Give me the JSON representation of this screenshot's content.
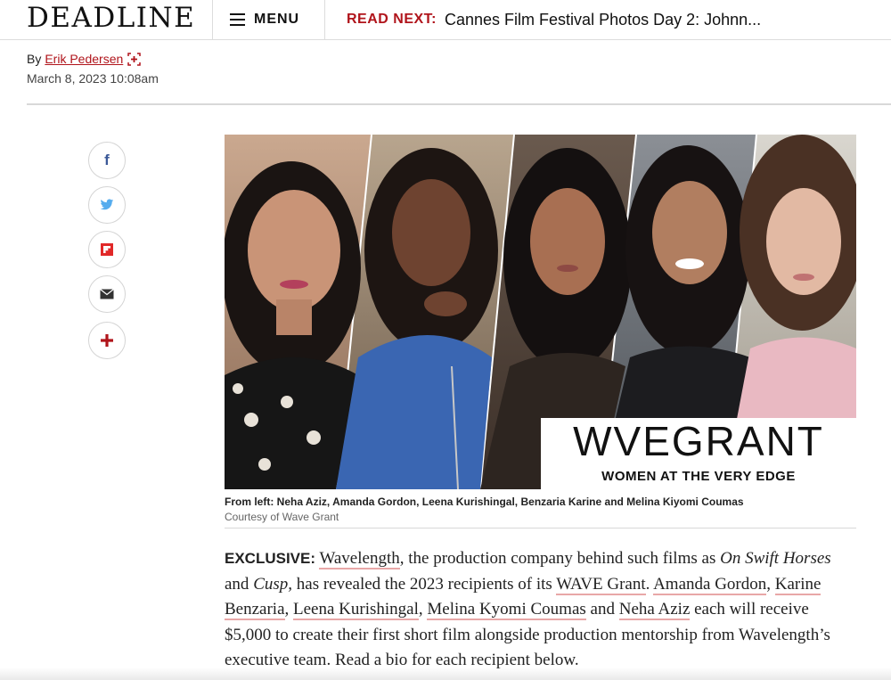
{
  "header": {
    "logo": "DEADLINE",
    "menu_label": "MENU",
    "read_next_label": "READ NEXT:",
    "read_next_title": "Cannes Film Festival Photos Day 2: Johnn..."
  },
  "byline": {
    "prefix": "By",
    "author": "Erik Pedersen",
    "date": "March 8, 2023 10:08am"
  },
  "share": [
    {
      "name": "facebook-icon",
      "glyph": "f",
      "color": "#3b5998"
    },
    {
      "name": "twitter-icon",
      "color": "#55acee"
    },
    {
      "name": "flipboard-icon",
      "color": "#e12828"
    },
    {
      "name": "email-icon",
      "color": "#333333"
    },
    {
      "name": "more-plus-icon",
      "color": "#b0141b"
    }
  ],
  "hero": {
    "logo_text": "WVEGRANT",
    "logo_subtitle": "WOMEN AT THE VERY EDGE",
    "caption": "From left: Neha Aziz, Amanda Gordon, Leena Kurishingal, Benzaria Karine and Melina Kiyomi Coumas",
    "credit": "Courtesy of Wave Grant"
  },
  "article": {
    "exclusive": "EXCLUSIVE:",
    "p1": "Wavelength",
    "p2": ", the production company behind such films as ",
    "p3": "On Swift Horses",
    "p4": " and ",
    "p5": "Cusp,",
    "p6": " has revealed the 2023 recipients of its ",
    "p7": "WAVE Grant",
    "p8": ". ",
    "p9": "Amanda Gordon",
    "p10": ", ",
    "p11": "Karine Benzaria",
    "p12": ", ",
    "p13": "Leena Kurishingal",
    "p14": ", ",
    "p15": "Melina Kyomi Coumas",
    "p16": " and ",
    "p17": "Neha Aziz",
    "p18": " each will receive $5,000 to create their first short film alongside production mentorship from Wavelength’s executive team. Read a bio for each recipient below."
  },
  "colors": {
    "brand_red": "#b0141b",
    "link_underline": "#e8a7a7"
  }
}
